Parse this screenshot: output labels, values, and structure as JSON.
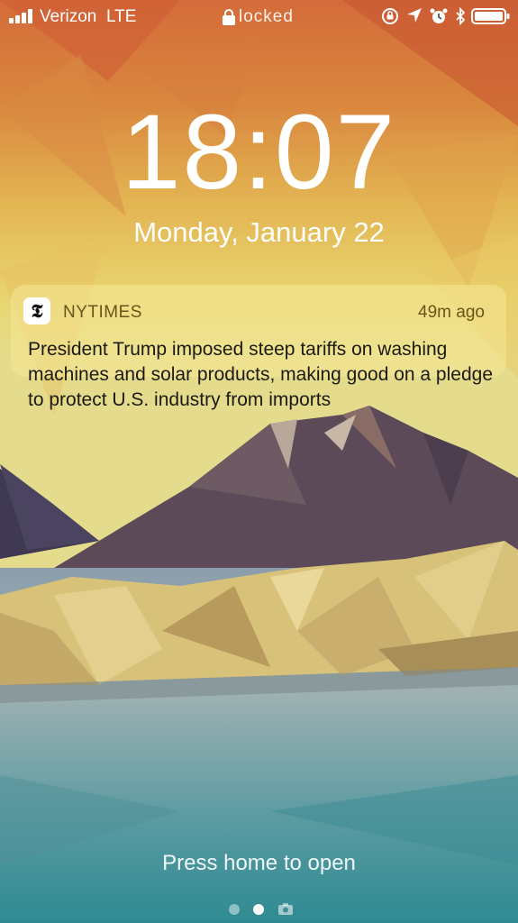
{
  "status_bar": {
    "carrier": "Verizon",
    "network": "LTE",
    "lock_label": "locked",
    "icons": [
      "signal-icon",
      "lock-icon",
      "orientation-lock-icon",
      "location-icon",
      "alarm-icon",
      "bluetooth-icon",
      "battery-icon"
    ]
  },
  "lockscreen": {
    "time": "18:07",
    "date": "Monday, January 22"
  },
  "notification": {
    "app": "NYTIMES",
    "time_ago": "49m ago",
    "message": "President Trump imposed steep tariffs on washing machines and solar products, making good on a pledge to protect U.S. industry from imports",
    "icon": "nytimes-icon",
    "icon_glyph": "𝕿"
  },
  "footer": {
    "hint": "Press home to open",
    "page_dots": 2,
    "active_dot": 1,
    "camera_icon": "camera-icon"
  },
  "colors": {
    "notification_bg": "#f5e896",
    "notification_accent": "#6a5418"
  }
}
